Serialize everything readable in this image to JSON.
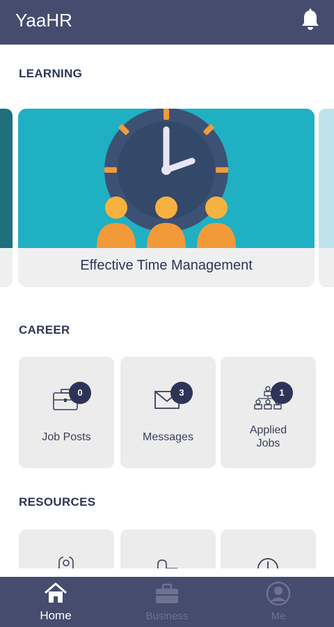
{
  "app": {
    "title": "YaaHR"
  },
  "header": {
    "notification_icon": "bell-icon"
  },
  "learning": {
    "section_title": "LEARNING",
    "featured_course": {
      "title": "Effective Time Management"
    }
  },
  "career": {
    "section_title": "CAREER",
    "tiles": [
      {
        "label": "Job Posts",
        "badge": "0",
        "icon": "briefcase-icon"
      },
      {
        "label": "Messages",
        "badge": "3",
        "icon": "envelope-icon"
      },
      {
        "label": "Applied\nJobs",
        "label_line1": "Applied",
        "label_line2": "Jobs",
        "badge": "1",
        "icon": "org-chart-icon"
      }
    ]
  },
  "resources": {
    "section_title": "RESOURCES",
    "tiles": [
      {
        "icon": "stethoscope-icon"
      },
      {
        "icon": "document-icon"
      },
      {
        "icon": "clock-history-icon"
      }
    ]
  },
  "bottom_nav": {
    "items": [
      {
        "label": "Home",
        "icon": "home-icon",
        "active": true
      },
      {
        "label": "Business",
        "icon": "briefcase-icon",
        "active": false
      },
      {
        "label": "Me",
        "icon": "user-icon",
        "active": false
      }
    ]
  },
  "colors": {
    "header_bg": "#454c6d",
    "accent_dark": "#2e3458",
    "card_bg": "#ececec",
    "illustration_bg": "#1fb0c3"
  }
}
